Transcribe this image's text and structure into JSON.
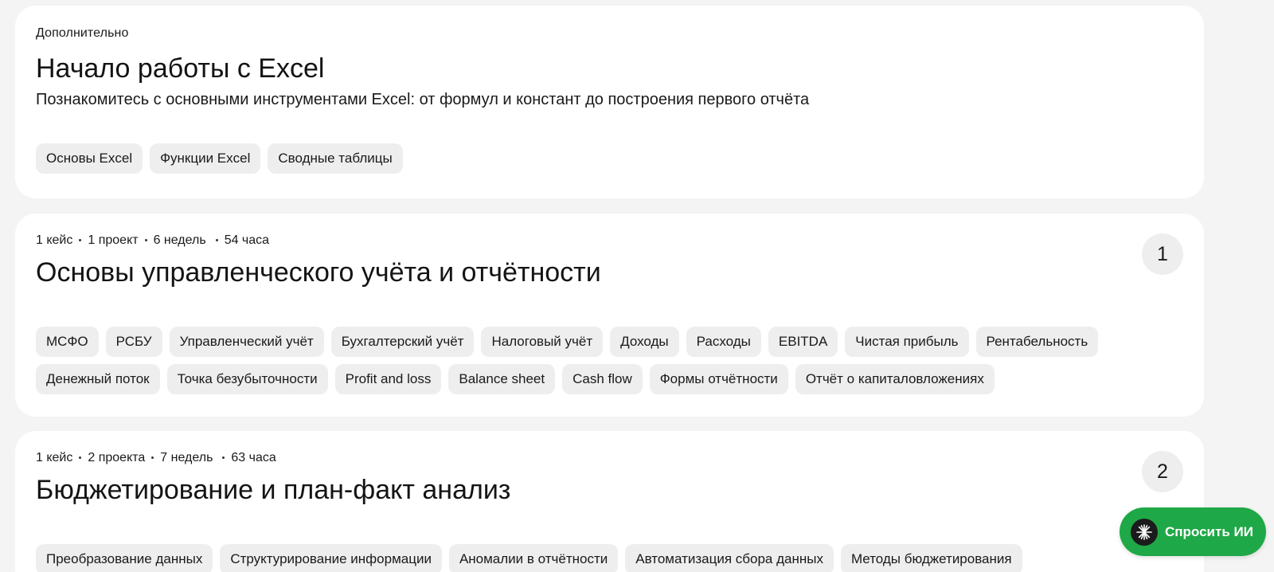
{
  "intro": {
    "eyebrow": "Дополнительно",
    "title": "Начало работы с Excel",
    "subtitle": "Познакомитесь с основными инструментами Excel: от формул и констант до построения первого отчёта",
    "tags": [
      "Основы Excel",
      "Функции Excel",
      "Сводные таблицы"
    ]
  },
  "module1": {
    "meta": [
      "1 кейс",
      "1 проект",
      "6 недель",
      "54 часа"
    ],
    "number": "1",
    "title": "Основы управленческого учёта и отчётности",
    "tags": [
      "МСФО",
      "РСБУ",
      "Управленческий учёт",
      "Бухгалтерский учёт",
      "Налоговый учёт",
      "Доходы",
      "Расходы",
      "EBITDA",
      "Чистая прибыль",
      "Рентабельность",
      "Денежный поток",
      "Точка безубыточности",
      "Profit and loss",
      "Balance sheet",
      "Cash flow",
      "Формы отчётности",
      "Отчёт о капиталовложениях"
    ]
  },
  "module2": {
    "meta": [
      "1 кейс",
      "2 проекта",
      "7 недель",
      "63 часа"
    ],
    "number": "2",
    "title": "Бюджетирование и план-факт анализ",
    "tags": [
      "Преобразование данных",
      "Структурирование информации",
      "Аномалии в отчётности",
      "Автоматизация сбора данных",
      "Методы бюджетирования"
    ]
  },
  "ai_button": {
    "label": "Спросить ИИ",
    "icon": "sparkle-icon",
    "color": "#1fa847"
  }
}
